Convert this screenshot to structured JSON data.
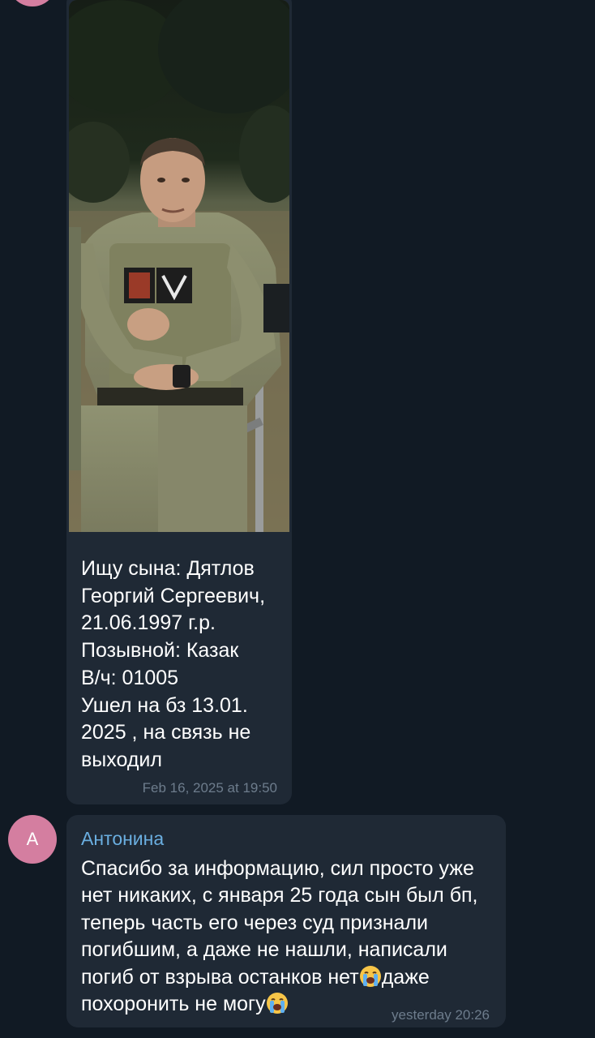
{
  "chat": {
    "top_avatar": {
      "initial": ""
    },
    "photo_message": {
      "text": "Ищу сына: Дятлов\nГеоргий Сергеевич,\n21.06.1997 г.р.\nПозывной: Казак\nВ/ч: 01005\nУшел на бз 13.01.\n2025 , на связь не\nвыходил",
      "timestamp": "Feb 16, 2025 at 19:50",
      "photo_description": "soldier-photo"
    },
    "reply_message": {
      "avatar_initial": "А",
      "sender": "Антонина",
      "text_part1": "Спасибо за информацию, сил просто уже нет никаких, с января 25 года сын был бп, теперь часть его через суд признали погибшим, а даже не нашли, написали погиб от взрыва останков нет",
      "text_part2": "даже похоронить не могу",
      "emoji_name": "loudly-crying-face",
      "timestamp": "yesterday 20:26"
    }
  },
  "colors": {
    "background": "#111a24",
    "bubble": "#1f2935",
    "sender_name": "#6aaee0",
    "timestamp": "#6d7c8c",
    "avatar": "#d47ea0"
  }
}
